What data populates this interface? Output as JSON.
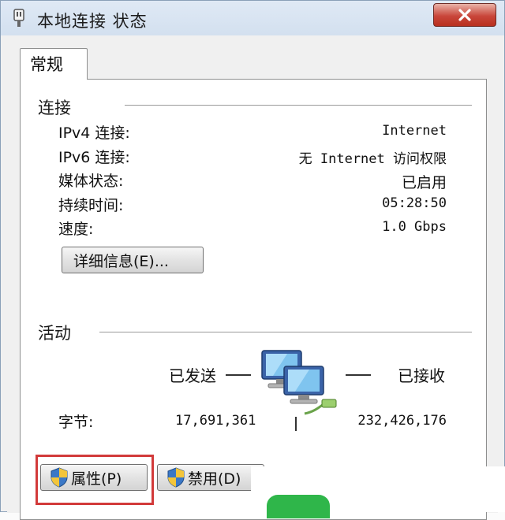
{
  "window": {
    "title": "本地连接 状态"
  },
  "tabs": [
    {
      "label": "常规",
      "active": true
    }
  ],
  "connection": {
    "group_title": "连接",
    "rows": [
      {
        "label": "IPv4 连接:",
        "value": "Internet"
      },
      {
        "label": "IPv6 连接:",
        "value": "无 Internet 访问权限"
      },
      {
        "label": "媒体状态:",
        "value": "已启用"
      },
      {
        "label": "持续时间:",
        "value": "05:28:50"
      },
      {
        "label": "速度:",
        "value": "1.0 Gbps"
      }
    ],
    "details_button": "详细信息(E)..."
  },
  "activity": {
    "group_title": "活动",
    "sent_label": "已发送",
    "received_label": "已接收",
    "bytes_label": "字节:",
    "bytes_sent": "17,691,361",
    "bytes_received": "232,426,176"
  },
  "buttons": {
    "properties": "属性(P)",
    "disable": "禁用(D)"
  },
  "colors": {
    "highlight": "#d23a3a",
    "close_button": "#c9463a",
    "title_gradient": "#dfe9f5"
  }
}
